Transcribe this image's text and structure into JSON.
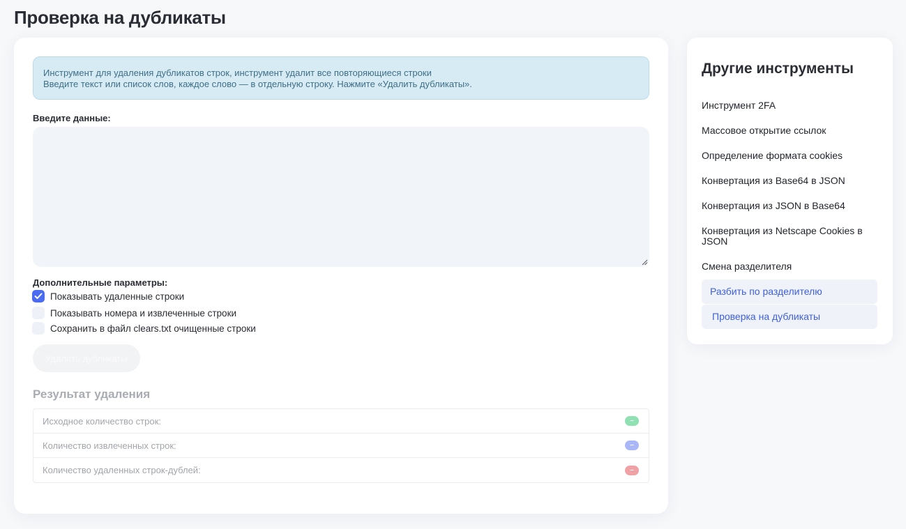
{
  "page": {
    "title": "Проверка на дубликаты"
  },
  "info": {
    "line1": "Инструмент для удаления дубликатов строк, инструмент удалит все повторяющиеся строки",
    "line2": "Введите текст или список слов, каждое слово — в отдельную строку. Нажмите «Удалить дубликаты»."
  },
  "input": {
    "label": "Введите данные:",
    "value": "",
    "placeholder": ""
  },
  "options": {
    "label": "Дополнительные параметры:",
    "items": [
      {
        "label": "Показывать удаленные строки",
        "checked": true
      },
      {
        "label": "Показывать номера и извлеченные строки",
        "checked": false
      },
      {
        "label": "Сохранить в файл clears.txt очищенные строки",
        "checked": false
      }
    ]
  },
  "actions": {
    "remove_label": "Удалить дубликаты"
  },
  "result": {
    "title": "Результат удаления",
    "rows": [
      {
        "label": "Исходное количество строк:",
        "value": "–",
        "color": "#8fe0b3"
      },
      {
        "label": "Количество извлеченных строк:",
        "value": "–",
        "color": "#a9b6f7"
      },
      {
        "label": "Количество удаленных строк-дублей:",
        "value": "–",
        "color": "#f0a1a5"
      }
    ]
  },
  "sidebar": {
    "title": "Другие инструменты",
    "items": [
      {
        "label": "Инструмент 2FA",
        "active": false
      },
      {
        "label": "Массовое открытие ссылок",
        "active": false
      },
      {
        "label": "Определение формата cookies",
        "active": false
      },
      {
        "label": "Конвертация из Base64 в JSON",
        "active": false
      },
      {
        "label": "Конвертация из JSON в Base64",
        "active": false
      },
      {
        "label": "Конвертация из Netscape Cookies в JSON",
        "active": false
      },
      {
        "label": "Смена разделителя",
        "active": false
      },
      {
        "label": "Разбить по разделителю",
        "active": true
      },
      {
        "label": "Проверка на дубликаты",
        "active": true
      }
    ]
  },
  "colors": {
    "accent": "#4b6cf0",
    "info_bg": "#d7ebf5",
    "active_link": "#3d5fe0"
  }
}
